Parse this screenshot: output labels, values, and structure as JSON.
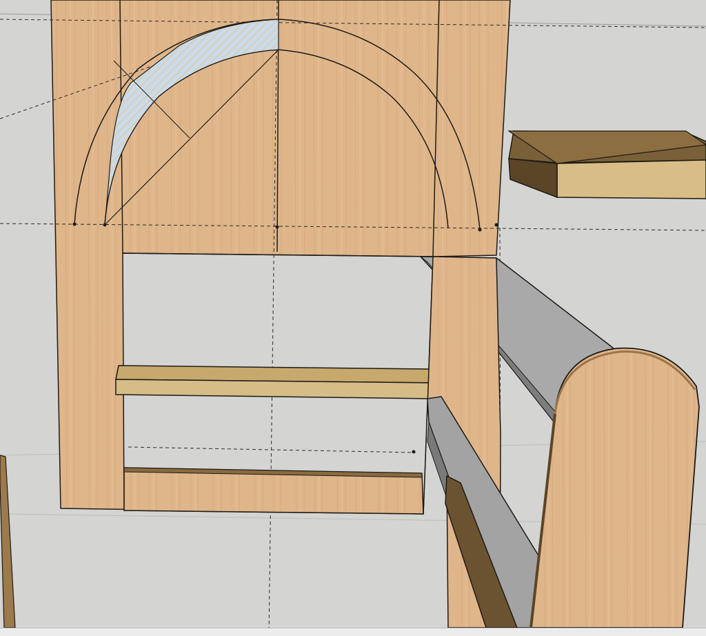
{
  "app": {
    "view": "3d-model-viewport",
    "status_text": ""
  },
  "colors": {
    "background": "#d4d4d2",
    "maple_face": "#dfb58a",
    "maple_light": "#e6c39a",
    "shelf_top": "#c7a86c",
    "shelf_side": "#6d5634",
    "selected_face": "#c9dbe9",
    "gray_board": "#a8a8a8",
    "gray_board_dark": "#7c7c7c",
    "edge": "#1d1a16"
  },
  "model": {
    "components": [
      "back-panel",
      "arch-guide-outer",
      "arch-guide-inner",
      "selected-arch-segment",
      "middle-shelf",
      "bottom-rail",
      "floating-shelf",
      "gray-top-board",
      "gray-lower-board",
      "side-panel",
      "end-post"
    ]
  }
}
